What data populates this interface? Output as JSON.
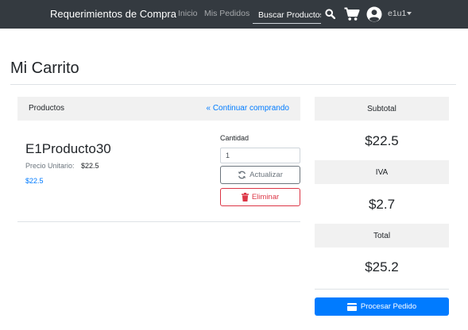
{
  "navbar": {
    "brand": "Requerimientos de Compra",
    "links": [
      "Inicio",
      "Mis Pedidos"
    ],
    "search_placeholder": "Buscar Productos",
    "search_icon": "search-icon",
    "cart_icon": "cart-icon",
    "user_icon": "user-circle-icon",
    "user": "e1u1"
  },
  "page": {
    "title": "Mi Carrito"
  },
  "cart": {
    "header_label": "Productos",
    "continue_link": "« Continuar comprando",
    "quantity_label": "Cantidad",
    "update_label": "Actualizar",
    "delete_label": "Eliminar",
    "items": [
      {
        "name": "E1Producto30",
        "unit_price_label": "Precio Unitario:",
        "unit_price": "$22.5",
        "line_total": "$22.5",
        "quantity": "1"
      }
    ]
  },
  "summary": {
    "subtotal_label": "Subtotal",
    "subtotal": "$22.5",
    "iva_label": "IVA",
    "iva": "$2.7",
    "total_label": "Total",
    "total": "$25.2",
    "process_label": "Procesar Pedido"
  },
  "colors": {
    "navbar": "#343a40",
    "primary": "#007bff",
    "danger": "#dc3545",
    "secondary": "#6c757d",
    "panel": "#f1f1f1"
  }
}
